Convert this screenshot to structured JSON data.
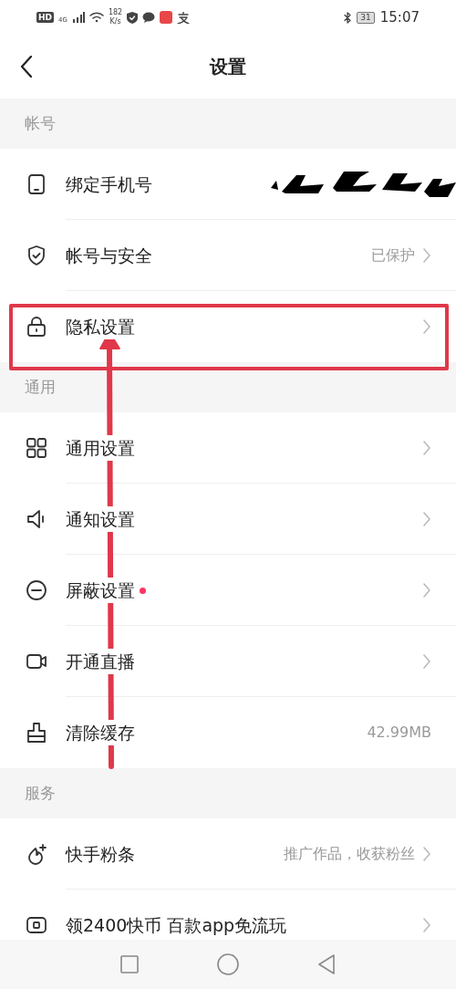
{
  "status_bar": {
    "hd": "HD",
    "network": "4G",
    "speed": "182",
    "speed_unit": "K/s",
    "battery": "31",
    "time": "15:07"
  },
  "header": {
    "title": "设置"
  },
  "sections": [
    {
      "title": "帐号",
      "rows": [
        {
          "label": "绑定手机号",
          "redacted": true,
          "chevron": false
        },
        {
          "label": "帐号与安全",
          "value": "已保护",
          "chevron": true
        },
        {
          "label": "隐私设置",
          "chevron": true,
          "highlighted": true
        }
      ]
    },
    {
      "title": "通用",
      "rows": [
        {
          "label": "通用设置",
          "chevron": true
        },
        {
          "label": "通知设置",
          "chevron": true
        },
        {
          "label": "屏蔽设置",
          "chevron": true,
          "dot": true
        },
        {
          "label": "开通直播",
          "chevron": true
        },
        {
          "label": "清除缓存",
          "value": "42.99MB",
          "chevron": false
        }
      ]
    },
    {
      "title": "服务",
      "rows": [
        {
          "label": "快手粉条",
          "value": "推广作品，收获粉丝",
          "chevron": true
        },
        {
          "label": "领2400快币 百款app免流玩",
          "chevron": true
        }
      ]
    }
  ],
  "annotation": {
    "arrow": true
  }
}
